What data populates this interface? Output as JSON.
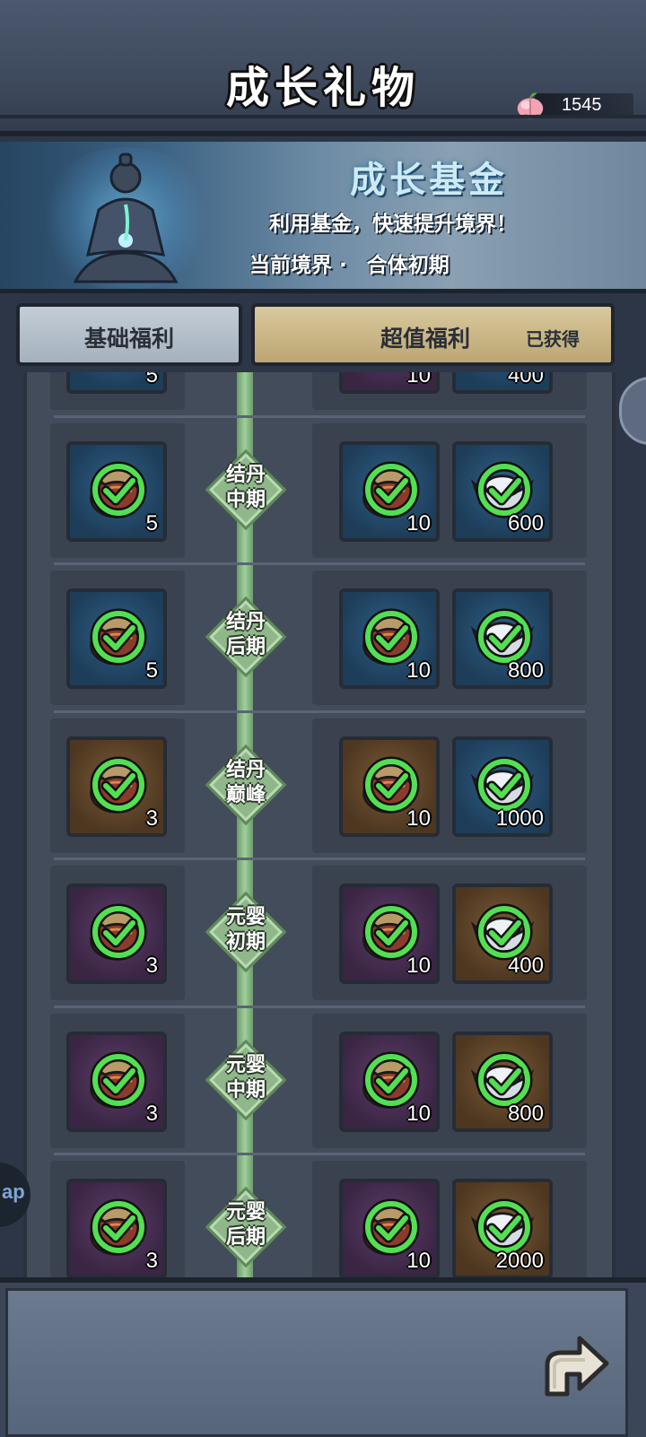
{
  "header": {
    "title": "成长礼物",
    "currency_icon": "peach-icon",
    "currency_value": "1545"
  },
  "banner": {
    "title": "成长基金",
    "subtitle": "利用基金，快速提升境界！",
    "realm_label": "当前境界 ·",
    "realm_value": "合体初期"
  },
  "tabs": [
    {
      "label": "基础福利",
      "active": false
    },
    {
      "label": "超值福利",
      "active": true,
      "badge": "已获得"
    }
  ],
  "rows": [
    {
      "stage": "",
      "free": {
        "qty": "5",
        "color": "blue"
      },
      "paid": [
        {
          "qty": "10",
          "color": "purple"
        },
        {
          "qty": "400",
          "color": "blue"
        }
      ]
    },
    {
      "stage": "结丹\n中期",
      "free": {
        "qty": "5",
        "color": "blue"
      },
      "paid": [
        {
          "qty": "10",
          "color": "blue"
        },
        {
          "qty": "600",
          "color": "blue"
        }
      ]
    },
    {
      "stage": "结丹\n后期",
      "free": {
        "qty": "5",
        "color": "blue"
      },
      "paid": [
        {
          "qty": "10",
          "color": "blue"
        },
        {
          "qty": "800",
          "color": "blue"
        }
      ]
    },
    {
      "stage": "结丹\n巅峰",
      "free": {
        "qty": "3",
        "color": "brown"
      },
      "paid": [
        {
          "qty": "10",
          "color": "brown"
        },
        {
          "qty": "1000",
          "color": "blue"
        }
      ]
    },
    {
      "stage": "元婴\n初期",
      "free": {
        "qty": "3",
        "color": "purple"
      },
      "paid": [
        {
          "qty": "10",
          "color": "purple"
        },
        {
          "qty": "400",
          "color": "brown"
        }
      ]
    },
    {
      "stage": "元婴\n中期",
      "free": {
        "qty": "3",
        "color": "purple"
      },
      "paid": [
        {
          "qty": "10",
          "color": "purple"
        },
        {
          "qty": "800",
          "color": "brown"
        }
      ]
    },
    {
      "stage": "元婴\n后期",
      "free": {
        "qty": "3",
        "color": "purple"
      },
      "paid": [
        {
          "qty": "10",
          "color": "purple"
        },
        {
          "qty": "2000",
          "color": "brown"
        }
      ]
    }
  ],
  "footer": {
    "return_icon": "return-arrow-icon"
  },
  "side_left_label": "ap",
  "colors": {
    "check": "#52e052",
    "spine": "#9fd09a",
    "tab_active": "#d9c99e",
    "tab_inactive": "#c3cdd6"
  }
}
